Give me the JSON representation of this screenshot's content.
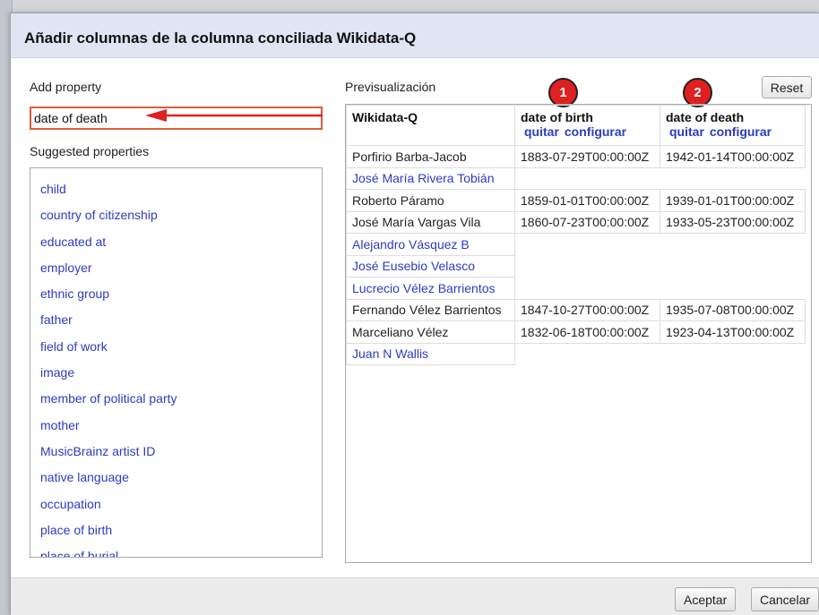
{
  "dialog": {
    "title": "Añadir columnas de la columna conciliada Wikidata-Q"
  },
  "left": {
    "add_property_label": "Add property",
    "search_value": "date of death",
    "suggested_label": "Suggested properties",
    "suggestions": [
      "child",
      "country of citizenship",
      "educated at",
      "employer",
      "ethnic group",
      "father",
      "field of work",
      "image",
      "member of political party",
      "mother",
      "MusicBrainz artist ID",
      "native language",
      "occupation",
      "place of birth",
      "place of burial"
    ]
  },
  "preview": {
    "label": "Previsualización",
    "reset_label": "Reset",
    "badges": [
      "1",
      "2"
    ],
    "columns": {
      "c0": "Wikidata-Q",
      "c1": "date of birth",
      "c2": "date of death",
      "remove_label": "quitar",
      "configure_label": "configurar"
    },
    "rows": [
      {
        "name": "Porfirio Barba-Jacob",
        "birth": "1883-07-29T00:00:00Z",
        "death": "1942-01-14T00:00:00Z"
      },
      {
        "name": "José María Rivera Tobián",
        "birth": "",
        "death": ""
      },
      {
        "name": "Roberto Páramo",
        "birth": "1859-01-01T00:00:00Z",
        "death": "1939-01-01T00:00:00Z"
      },
      {
        "name": "José María Vargas Vila",
        "birth": "1860-07-23T00:00:00Z",
        "death": "1933-05-23T00:00:00Z"
      },
      {
        "name": "Alejandro Vásquez B",
        "birth": "",
        "death": ""
      },
      {
        "name": "José Eusebio Velasco",
        "birth": "",
        "death": ""
      },
      {
        "name": "Lucrecio Vélez Barrientos",
        "birth": "",
        "death": ""
      },
      {
        "name": "Fernando Vélez Barrientos",
        "birth": "1847-10-27T00:00:00Z",
        "death": "1935-07-08T00:00:00Z"
      },
      {
        "name": "Marceliano Vélez",
        "birth": "1832-06-18T00:00:00Z",
        "death": "1923-04-13T00:00:00Z"
      },
      {
        "name": "Juan N Wallis",
        "birth": "",
        "death": ""
      }
    ]
  },
  "footer": {
    "ok_label": "Aceptar",
    "cancel_label": "Cancelar"
  },
  "colors": {
    "link": "#2b3cc4",
    "badge": "#e02020",
    "highlight_border": "#e05c3c",
    "header_bg": "#dde6f2"
  }
}
